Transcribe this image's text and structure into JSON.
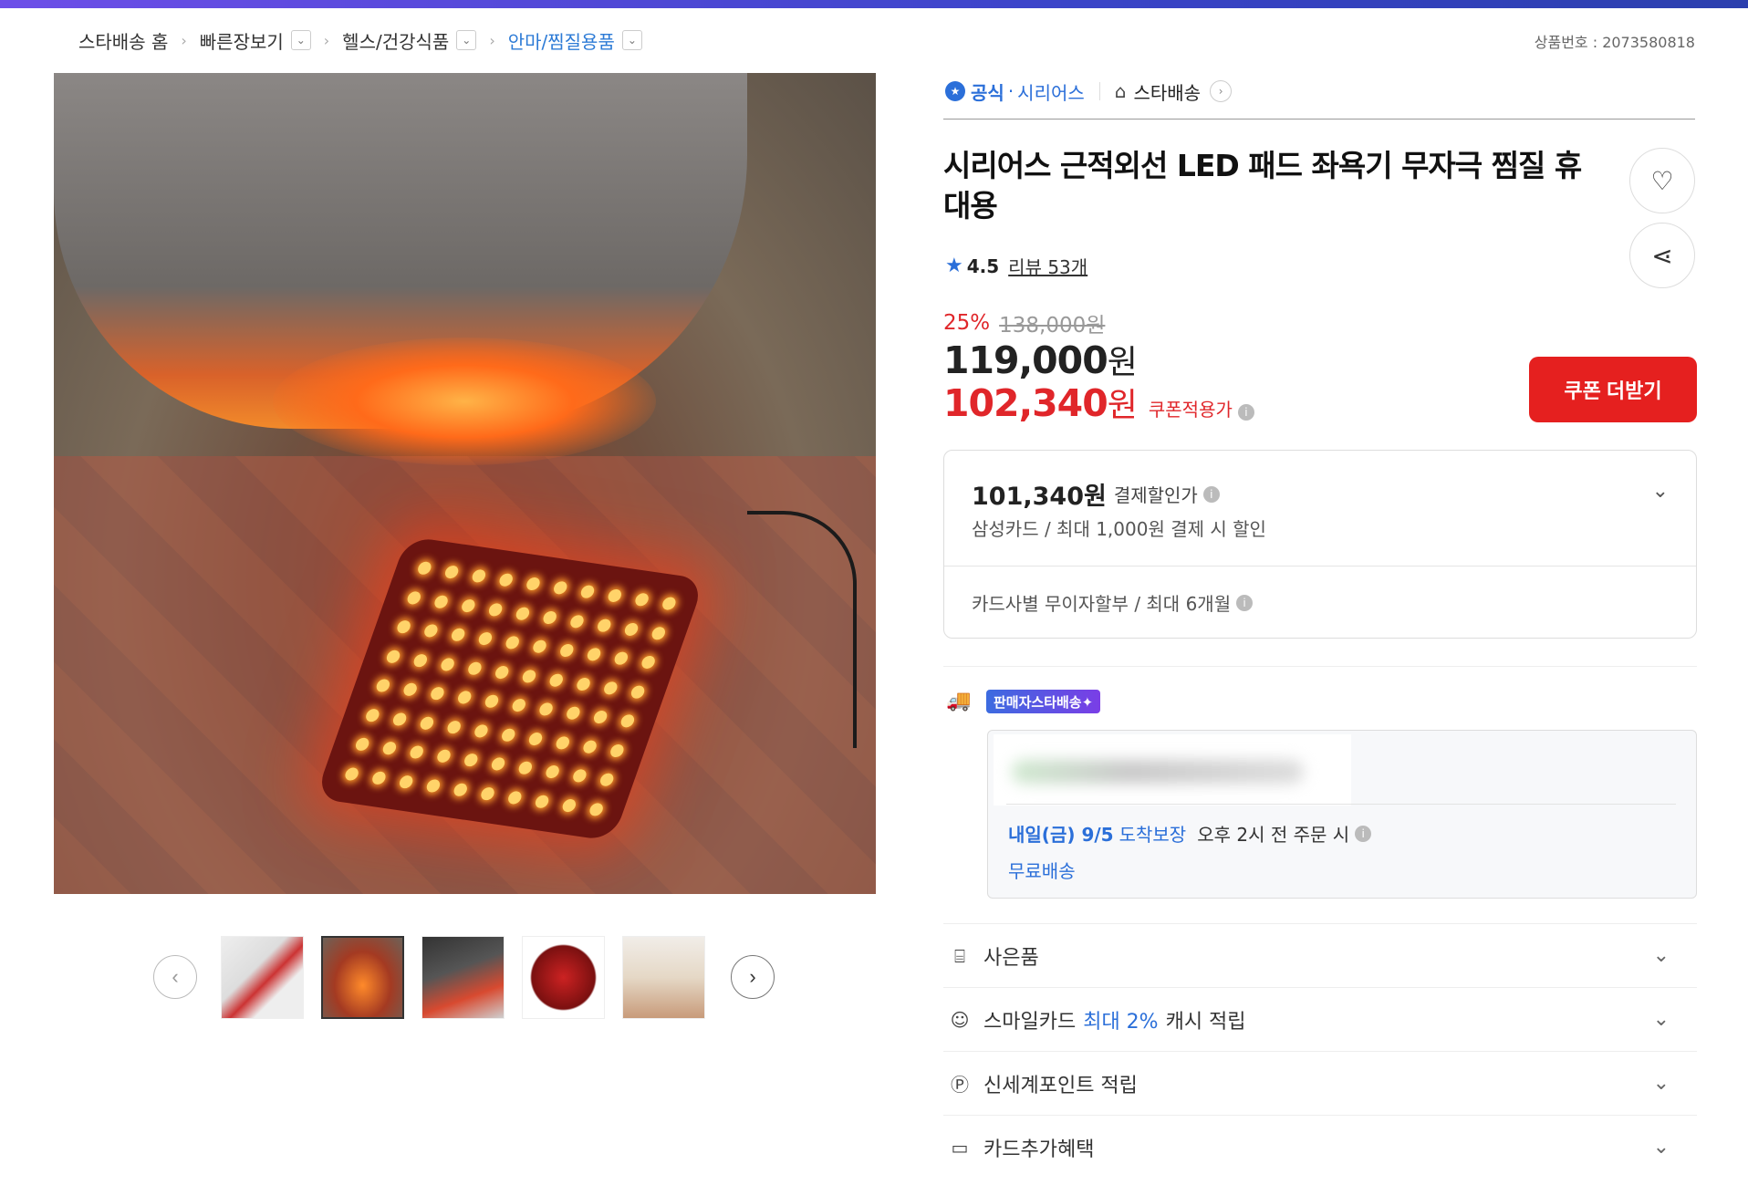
{
  "colors": {
    "accent": "#2b6fd9",
    "sale": "#e0262a",
    "coupon_button": "#e5201f"
  },
  "breadcrumb": [
    {
      "label": "스타배송 홈",
      "dropdown": false
    },
    {
      "label": "빠른장보기",
      "dropdown": true
    },
    {
      "label": "헬스/건강식품",
      "dropdown": true
    },
    {
      "label": "안마/찜질용품",
      "dropdown": true
    }
  ],
  "product_number": "상품번호 : 2073580818",
  "brand": {
    "official": "공식",
    "dot": "·",
    "name": "시리어스",
    "shipping_store": "스타배송"
  },
  "title": "시리어스 근적외선 LED 패드 좌욕기 무자극 찜질 휴대용",
  "rating": {
    "score": "4.5",
    "reviews": "리뷰 53개"
  },
  "price": {
    "discount": "25%",
    "original": "138,000원",
    "sale_amount": "119,000",
    "won": "원",
    "coupon_amount": "102,340",
    "coupon_label": "쿠폰적용가"
  },
  "coupon_button": "쿠폰 더받기",
  "payment": {
    "amount": "101,340원",
    "label": "결제할인가",
    "sub": "삼성카드 / 최대 1,000원 결제 시 할인",
    "installment": "카드사별 무이자할부 / 최대 6개월"
  },
  "shipping": {
    "badge": "판매자스타배송✦",
    "date": "내일(금) 9/5",
    "guarantee": "도착보장",
    "condition": "오후 2시 전 주문 시",
    "free": "무료배송"
  },
  "benefits": [
    {
      "icon": "gift-icon",
      "label": "사은품",
      "highlight": "",
      "suffix": ""
    },
    {
      "icon": "smile-card-icon",
      "label": "스마일카드",
      "highlight": "최대 2%",
      "suffix": "캐시 적립"
    },
    {
      "icon": "point-icon",
      "label": "신세계포인트 적립",
      "highlight": "",
      "suffix": ""
    },
    {
      "icon": "card-icon",
      "label": "카드추가혜택",
      "highlight": "",
      "suffix": ""
    }
  ],
  "thumbnails": [
    "thumb-1",
    "thumb-2",
    "thumb-3",
    "thumb-4",
    "thumb-5"
  ]
}
